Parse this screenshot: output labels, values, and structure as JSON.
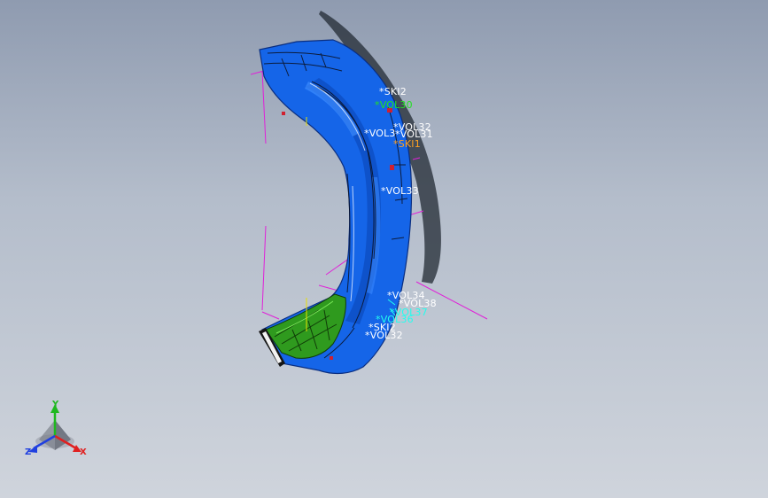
{
  "viewport": {
    "background_top": "#8f9bb0",
    "background_bottom": "#cfd4dc",
    "model": {
      "part": "bumper",
      "body_color": "#1565e8",
      "support_color": "#2f9a1e",
      "shadow_color": "#222933",
      "sketch_line_color": "#e020d8"
    },
    "callouts": [
      {
        "id": "ski2-top",
        "text": "*SKI2",
        "color": "#ffffff"
      },
      {
        "id": "vol30",
        "text": "*VOL30",
        "color": "#22e022"
      },
      {
        "id": "vol32-top",
        "text": "*VOL32",
        "color": "#ffffff"
      },
      {
        "id": "vol3-left",
        "text": "*VOL3",
        "color": "#ffffff"
      },
      {
        "id": "vol31",
        "text": "*VOL31",
        "color": "#ffffff"
      },
      {
        "id": "ski1",
        "text": "*SKI1",
        "color": "#ffa020"
      },
      {
        "id": "vol33",
        "text": "*VOL33",
        "color": "#ffffff"
      },
      {
        "id": "vol34",
        "text": "*VOL34",
        "color": "#ffffff"
      },
      {
        "id": "vol38",
        "text": "*VOL38",
        "color": "#ffffff"
      },
      {
        "id": "vol37",
        "text": "*VOL37",
        "color": "#22ffee"
      },
      {
        "id": "vol36",
        "text": "*VOL36",
        "color": "#22ffee"
      },
      {
        "id": "ski2-bottom",
        "text": "*SKI2",
        "color": "#ffffff"
      },
      {
        "id": "vol32-bottom",
        "text": "*VOL32",
        "color": "#ffffff"
      }
    ]
  },
  "triad": {
    "x_label": "X",
    "y_label": "Y",
    "z_label": "Z",
    "x_color": "#e02020",
    "y_color": "#1fb81f",
    "z_color": "#2040e0"
  }
}
